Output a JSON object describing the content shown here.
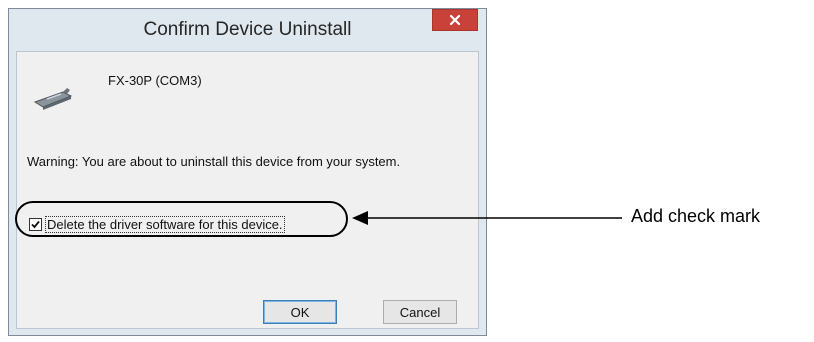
{
  "window": {
    "title": "Confirm Device Uninstall",
    "close_icon": "close-icon"
  },
  "device": {
    "icon": "serial-device-icon",
    "name": "FX-30P (COM3)"
  },
  "warning": "Warning: You are about to uninstall this device from your system.",
  "checkbox": {
    "label": "Delete the driver software for this device.",
    "checked": true
  },
  "buttons": {
    "ok": "OK",
    "cancel": "Cancel"
  },
  "annotation": {
    "text": "Add check mark"
  },
  "colors": {
    "close_button": "#c8423a",
    "frame": "#dfe7ef",
    "client": "#f0f0f0"
  }
}
